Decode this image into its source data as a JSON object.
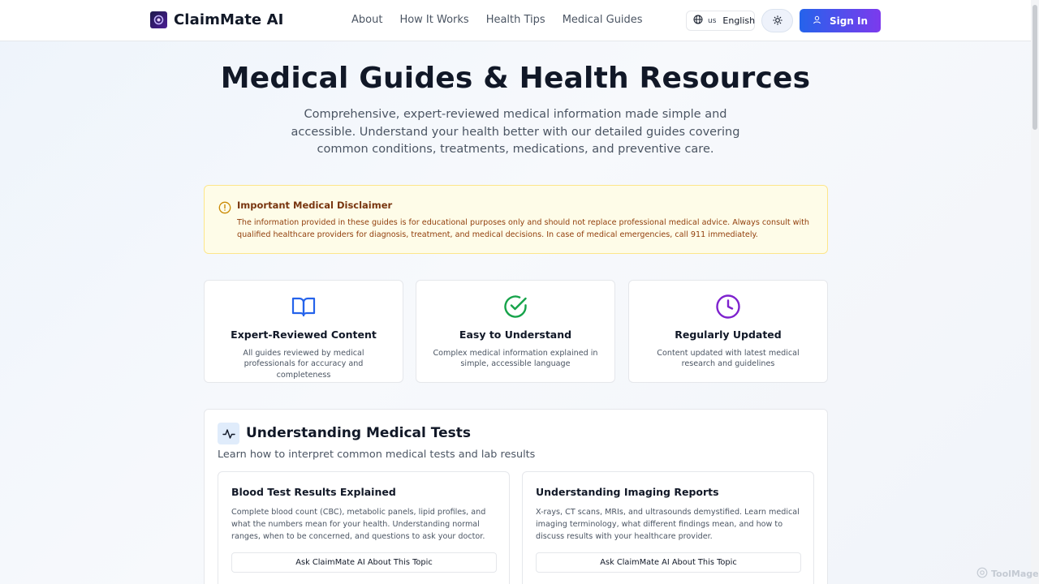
{
  "header": {
    "brand": "ClaimMate AI",
    "nav": [
      "About",
      "How It Works",
      "Health Tips",
      "Medical Guides"
    ],
    "language_flag": "us",
    "language": "English",
    "signin_label": "Sign In"
  },
  "hero": {
    "title": "Medical Guides & Health Resources",
    "subtitle": "Comprehensive, expert-reviewed medical information made simple and accessible. Understand your health better with our detailed guides covering common conditions, treatments, medications, and preventive care."
  },
  "disclaimer": {
    "title": "Important Medical Disclaimer",
    "text": "The information provided in these guides is for educational purposes only and should not replace professional medical advice. Always consult with qualified healthcare providers for diagnosis, treatment, and medical decisions. In case of medical emergencies, call 911 immediately."
  },
  "features": [
    {
      "icon": "book-icon",
      "title": "Expert-Reviewed Content",
      "text": "All guides reviewed by medical professionals for accuracy and completeness",
      "color": "#2563eb"
    },
    {
      "icon": "check-circle-icon",
      "title": "Easy to Understand",
      "text": "Complex medical information explained in simple, accessible language",
      "color": "#16a34a"
    },
    {
      "icon": "clock-icon",
      "title": "Regularly Updated",
      "text": "Content updated with latest medical research and guidelines",
      "color": "#7e22ce"
    }
  ],
  "section": {
    "icon": "activity-icon",
    "title": "Understanding Medical Tests",
    "description": "Learn how to interpret common medical tests and lab results",
    "cards": [
      {
        "title": "Blood Test Results Explained",
        "text": "Complete blood count (CBC), metabolic panels, lipid profiles, and what the numbers mean for your health. Understanding normal ranges, when to be concerned, and questions to ask your doctor.",
        "button": "Ask ClaimMate AI About This Topic"
      },
      {
        "title": "Understanding Imaging Reports",
        "text": "X-rays, CT scans, MRIs, and ultrasounds demystified. Learn medical imaging terminology, what different findings mean, and how to discuss results with your healthcare provider.",
        "button": "Ask ClaimMate AI About This Topic"
      }
    ]
  },
  "watermark": "ToolMage",
  "colors": {
    "accent_start": "#2563eb",
    "accent_end": "#7c3aed",
    "disclaimer_bg": "#fefce8"
  }
}
